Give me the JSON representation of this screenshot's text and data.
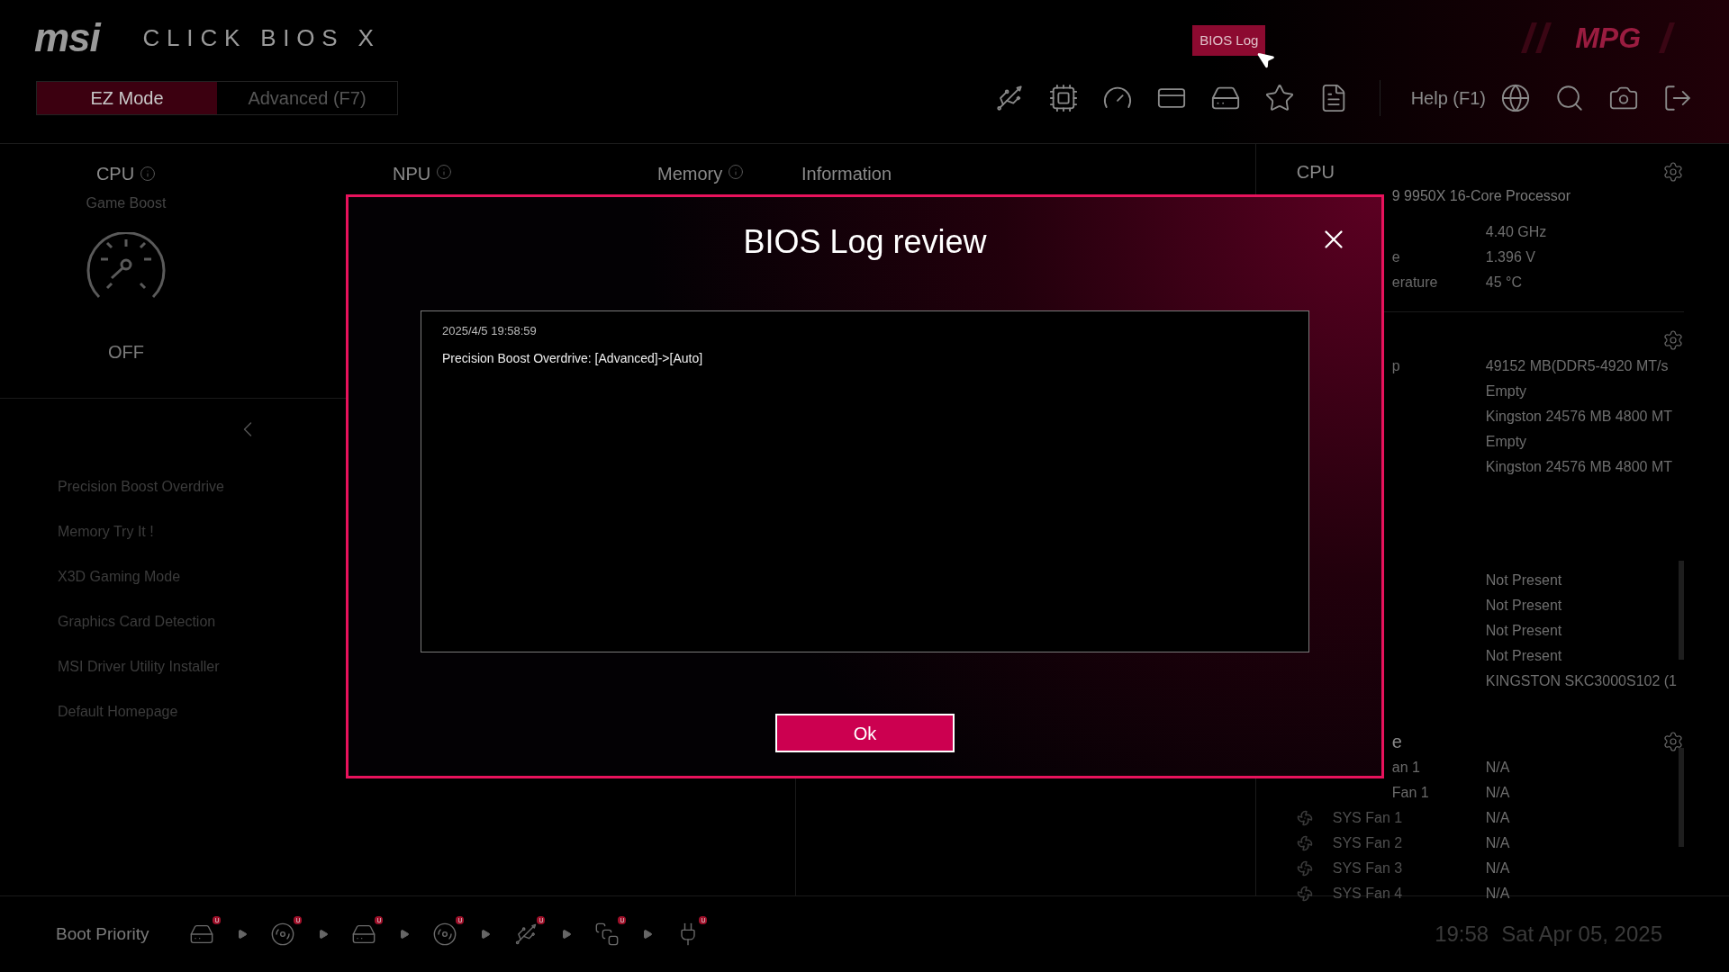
{
  "header": {
    "logo": "msi",
    "product": "CLICK BIOS X",
    "brand": "MPG",
    "modes": [
      {
        "label": "EZ Mode",
        "selected": true
      },
      {
        "label": "Advanced (F7)",
        "selected": false
      }
    ],
    "tooltip": "BIOS Log",
    "help": "Help (F1)"
  },
  "overview": {
    "cpu": {
      "title": "CPU",
      "subtitle": "Game Boost",
      "state": "OFF"
    },
    "headings": [
      {
        "label": "NPU",
        "info": true
      },
      {
        "label": "Memory",
        "info": true
      },
      {
        "label": "Information",
        "info": false
      }
    ]
  },
  "menu": [
    "Precision Boost Overdrive",
    "Memory Try It !",
    "X3D Gaming Mode",
    "Graphics Card Detection",
    "MSI Driver Utility Installer",
    "Default Homepage"
  ],
  "right_panel": [
    {
      "title": "CPU",
      "subtitle": "9 9950X 16-Core Processor",
      "gear": true,
      "scrollbar": false,
      "rows": [
        {
          "kind": "covered",
          "value": "4.40 GHz"
        },
        {
          "kind": "covered",
          "label": "e",
          "value": "1.396 V"
        },
        {
          "kind": "covered",
          "label": "erature",
          "value": "45 °C"
        }
      ]
    },
    {
      "gear": true,
      "scrollbar": false,
      "rows": [
        {
          "kind": "covered",
          "label": "p",
          "value": "49152 MB(DDR5-4920 MT/s"
        },
        {
          "kind": "covered",
          "value": "Empty"
        },
        {
          "kind": "covered",
          "value": "Kingston 24576 MB 4800 MT"
        },
        {
          "kind": "covered",
          "value": "Empty"
        },
        {
          "kind": "covered",
          "value": "Kingston 24576 MB 4800 MT"
        }
      ]
    },
    {
      "gear": false,
      "scrollbar": true,
      "rows": [
        {
          "kind": "covered",
          "value": "Not Present"
        },
        {
          "kind": "covered",
          "value": "Not Present"
        },
        {
          "kind": "covered",
          "value": "Not Present"
        },
        {
          "kind": "covered",
          "value": "Not Present"
        },
        {
          "kind": "covered",
          "value": "KINGSTON SKC3000S102 (1"
        }
      ]
    },
    {
      "title": "e",
      "title_covered": true,
      "gear": true,
      "scrollbar": true,
      "rows": [
        {
          "kind": "covered",
          "label": "an 1",
          "value": "N/A"
        },
        {
          "kind": "covered",
          "label": "Fan 1",
          "value": "N/A"
        },
        {
          "kind": "fan",
          "label": "SYS Fan 1",
          "value": "N/A"
        },
        {
          "kind": "fan",
          "label": "SYS Fan 2",
          "value": "N/A"
        },
        {
          "kind": "fan",
          "label": "SYS Fan 3",
          "value": "N/A"
        },
        {
          "kind": "fan",
          "label": "SYS Fan 4",
          "value": "N/A"
        }
      ]
    }
  ],
  "boot": {
    "label": "Boot Priority",
    "devices": [
      {
        "kind": "hdd",
        "badge": "U"
      },
      {
        "kind": "disc",
        "badge": "U"
      },
      {
        "kind": "hdd",
        "badge": "U"
      },
      {
        "kind": "disc",
        "badge": "U"
      },
      {
        "kind": "usb",
        "badge": "U"
      },
      {
        "kind": "card",
        "badge": "U"
      },
      {
        "kind": "plug",
        "badge": "U"
      }
    ]
  },
  "clock": {
    "time": "19:58",
    "date": "Sat Apr 05, 2025"
  },
  "dialog": {
    "title": "BIOS Log review",
    "entries": [
      "2025/4/5 19:58:59",
      "Precision Boost Overdrive: [Advanced]->[Auto]"
    ],
    "button": "Ok"
  }
}
